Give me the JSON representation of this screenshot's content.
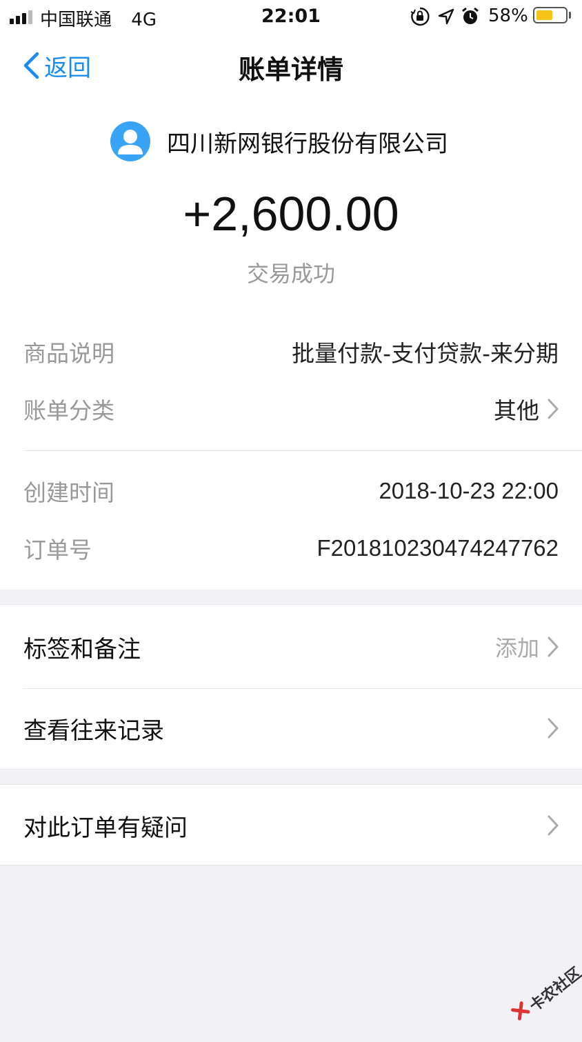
{
  "status_bar": {
    "carrier": "中国联通",
    "network": "4G",
    "time": "22:01",
    "battery_percent": "58%",
    "battery_level": 0.58,
    "icons": [
      "orientation-lock-icon",
      "location-arrow-icon",
      "alarm-icon"
    ]
  },
  "nav": {
    "back_label": "返回",
    "title": "账单详情"
  },
  "payer": {
    "name": "四川新网银行股份有限公司",
    "avatar_icon": "user-avatar-icon"
  },
  "transaction": {
    "amount": "+2,600.00",
    "status": "交易成功"
  },
  "details": [
    {
      "label": "商品说明",
      "value": "批量付款-支付贷款-来分期",
      "chevron": false
    },
    {
      "label": "账单分类",
      "value": "其他",
      "chevron": true
    },
    {
      "label": "创建时间",
      "value": "2018-10-23 22:00",
      "chevron": false
    },
    {
      "label": "订单号",
      "value": "F2018102304742477 62",
      "chevron": false
    }
  ],
  "actions": {
    "tags_label": "标签和备注",
    "tags_action": "添加",
    "history_label": "查看往来记录",
    "question_label": "对此订单有疑问"
  },
  "watermark": {
    "text": "卡农社区"
  },
  "colors": {
    "accent": "#1a8cf0",
    "avatar": "#39a4f5",
    "battery": "#f7c51a",
    "background": "#f1f1f6"
  }
}
